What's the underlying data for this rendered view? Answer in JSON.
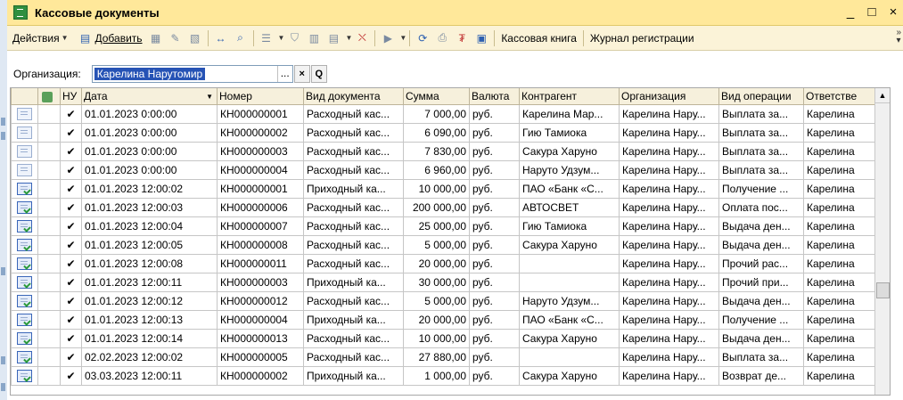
{
  "window": {
    "title": "Кассовые документы",
    "minimize": "_",
    "maximize": "□",
    "close": "×"
  },
  "toolbar": {
    "actions_label": "Действия",
    "add_label": "Добавить",
    "cashbook_label": "Кассовая книга",
    "journal_label": "Журнал регистрации",
    "more": "»"
  },
  "filter": {
    "label": "Организация:",
    "value": "Карелина Нарутомир",
    "dots": "...",
    "clear": "×",
    "search": "Q"
  },
  "table": {
    "columns": [
      "",
      "",
      "НУ",
      "Дата",
      "Номер",
      "Вид документа",
      "Сумма",
      "Валюта",
      "Контрагент",
      "Организация",
      "Вид операции",
      "Ответстве"
    ],
    "rows": [
      {
        "posted": false,
        "nu": "✔",
        "date": "01.01.2023 0:00:00",
        "number": "КН000000001",
        "doctype": "Расходный кас...",
        "sum": "7 000,00",
        "currency": "руб.",
        "contractor": "Карелина Мар...",
        "org": "Карелина Нару...",
        "op": "Выплата за...",
        "resp": "Карелина"
      },
      {
        "posted": false,
        "nu": "✔",
        "date": "01.01.2023 0:00:00",
        "number": "КН000000002",
        "doctype": "Расходный кас...",
        "sum": "6 090,00",
        "currency": "руб.",
        "contractor": "Гию Тамиока",
        "org": "Карелина Нару...",
        "op": "Выплата за...",
        "resp": "Карелина"
      },
      {
        "posted": false,
        "nu": "✔",
        "date": "01.01.2023 0:00:00",
        "number": "КН000000003",
        "doctype": "Расходный кас...",
        "sum": "7 830,00",
        "currency": "руб.",
        "contractor": "Сакура Харуно",
        "org": "Карелина Нару...",
        "op": "Выплата за...",
        "resp": "Карелина"
      },
      {
        "posted": false,
        "nu": "✔",
        "date": "01.01.2023 0:00:00",
        "number": "КН000000004",
        "doctype": "Расходный кас...",
        "sum": "6 960,00",
        "currency": "руб.",
        "contractor": "Наруто Удзум...",
        "org": "Карелина Нару...",
        "op": "Выплата за...",
        "resp": "Карелина"
      },
      {
        "posted": true,
        "nu": "✔",
        "date": "01.01.2023 12:00:02",
        "number": "КН000000001",
        "doctype": "Приходный ка...",
        "sum": "10 000,00",
        "currency": "руб.",
        "contractor": "ПАО «Банк «С...",
        "org": "Карелина Нару...",
        "op": "Получение ...",
        "resp": "Карелина"
      },
      {
        "posted": true,
        "nu": "✔",
        "date": "01.01.2023 12:00:03",
        "number": "КН000000006",
        "doctype": "Расходный кас...",
        "sum": "200 000,00",
        "currency": "руб.",
        "contractor": "АВТОСВЕТ",
        "org": "Карелина Нару...",
        "op": "Оплата пос...",
        "resp": "Карелина"
      },
      {
        "posted": true,
        "nu": "✔",
        "date": "01.01.2023 12:00:04",
        "number": "КН000000007",
        "doctype": "Расходный кас...",
        "sum": "25 000,00",
        "currency": "руб.",
        "contractor": "Гию Тамиока",
        "org": "Карелина Нару...",
        "op": "Выдача ден...",
        "resp": "Карелина"
      },
      {
        "posted": true,
        "nu": "✔",
        "date": "01.01.2023 12:00:05",
        "number": "КН000000008",
        "doctype": "Расходный кас...",
        "sum": "5 000,00",
        "currency": "руб.",
        "contractor": "Сакура Харуно",
        "org": "Карелина Нару...",
        "op": "Выдача ден...",
        "resp": "Карелина"
      },
      {
        "posted": true,
        "nu": "✔",
        "date": "01.01.2023 12:00:08",
        "number": "КН000000011",
        "doctype": "Расходный кас...",
        "sum": "20 000,00",
        "currency": "руб.",
        "contractor": "",
        "org": "Карелина Нару...",
        "op": "Прочий рас...",
        "resp": "Карелина"
      },
      {
        "posted": true,
        "nu": "✔",
        "date": "01.01.2023 12:00:11",
        "number": "КН000000003",
        "doctype": "Приходный ка...",
        "sum": "30 000,00",
        "currency": "руб.",
        "contractor": "",
        "org": "Карелина Нару...",
        "op": "Прочий при...",
        "resp": "Карелина"
      },
      {
        "posted": true,
        "nu": "✔",
        "date": "01.01.2023 12:00:12",
        "number": "КН000000012",
        "doctype": "Расходный кас...",
        "sum": "5 000,00",
        "currency": "руб.",
        "contractor": "Наруто Удзум...",
        "org": "Карелина Нару...",
        "op": "Выдача ден...",
        "resp": "Карелина"
      },
      {
        "posted": true,
        "nu": "✔",
        "date": "01.01.2023 12:00:13",
        "number": "КН000000004",
        "doctype": "Приходный ка...",
        "sum": "20 000,00",
        "currency": "руб.",
        "contractor": "ПАО «Банк «С...",
        "org": "Карелина Нару...",
        "op": "Получение ...",
        "resp": "Карелина"
      },
      {
        "posted": true,
        "nu": "✔",
        "date": "01.01.2023 12:00:14",
        "number": "КН000000013",
        "doctype": "Расходный кас...",
        "sum": "10 000,00",
        "currency": "руб.",
        "contractor": "Сакура Харуно",
        "org": "Карелина Нару...",
        "op": "Выдача ден...",
        "resp": "Карелина"
      },
      {
        "posted": true,
        "nu": "✔",
        "date": "02.02.2023 12:00:02",
        "number": "КН000000005",
        "doctype": "Расходный кас...",
        "sum": "27 880,00",
        "currency": "руб.",
        "contractor": "",
        "org": "Карелина Нару...",
        "op": "Выплата за...",
        "resp": "Карелина"
      },
      {
        "posted": true,
        "nu": "✔",
        "date": "03.03.2023 12:00:11",
        "number": "КН000000002",
        "doctype": "Приходный ка...",
        "sum": "1 000,00",
        "currency": "руб.",
        "contractor": "Сакура Харуно",
        "org": "Карелина Нару...",
        "op": "Возврат де...",
        "resp": "Карелина"
      }
    ]
  }
}
